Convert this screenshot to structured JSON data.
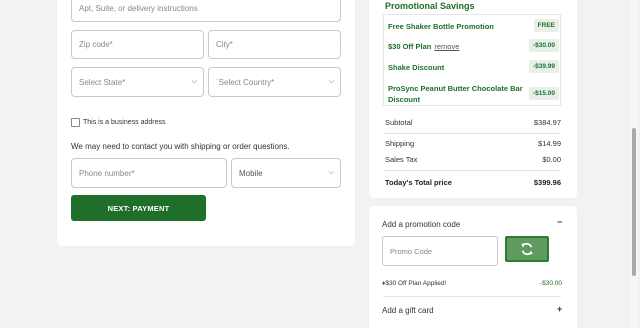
{
  "form": {
    "address2_placeholder": "Apt, Suite, or delivery instructions",
    "zip_placeholder": "Zip code*",
    "city_placeholder": "City*",
    "state_placeholder": "Select State*",
    "country_placeholder": "`Select Country*",
    "business_label": "This is a business address",
    "contact_note": "We may need to contact you with shipping or order questions.",
    "phone_placeholder": "Phone number*",
    "phone_type": "Mobile",
    "next_button": "NEXT: PAYMENT"
  },
  "promotions": {
    "heading": "Promotional Savings",
    "items": [
      {
        "label": "Free Shaker Bottle Promotion",
        "value": "FREE"
      },
      {
        "label": "$30 Off Plan",
        "link": "remove",
        "value": "-$30.00"
      },
      {
        "label": "Shake Discount",
        "value": "-$39.99"
      },
      {
        "label": "ProSync Peanut Butter Chocolate Bar Discount",
        "value": "-$15.00"
      }
    ]
  },
  "summary": {
    "subtotal_label": "Subtotal",
    "subtotal": "$384.97",
    "shipping_label": "Shipping",
    "shipping": "$14.99",
    "tax_label": "Sales Tax",
    "tax": "$0.00",
    "total_label": "Today's Total price",
    "total": "$399.96"
  },
  "promo_code": {
    "heading": "Add a promotion code",
    "toggle": "−",
    "placeholder": "Promo Code",
    "applied_label": "$30 Off Plan",
    "applied_status": " Applied!",
    "applied_value": "-$30.00"
  },
  "gift_card": {
    "heading": "Add a gift card",
    "toggle": "+"
  },
  "colors": {
    "brand_green": "#1f6f2a",
    "apply_green": "#5f9a5f"
  }
}
